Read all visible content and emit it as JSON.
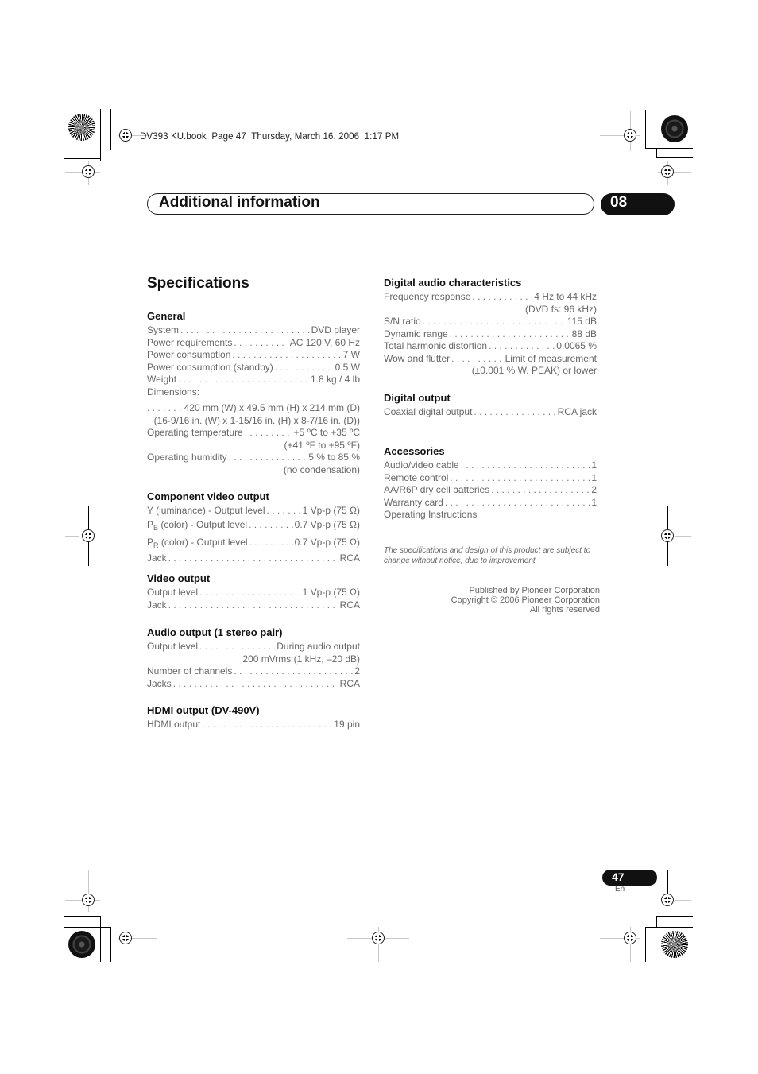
{
  "print_header": "DV393 KU.book  Page 47  Thursday, March 16, 2006  1:17 PM",
  "section_bar": {
    "title": "Additional information",
    "chapter": "08"
  },
  "page_title": "Specifications",
  "left_column": [
    {
      "heading": "General",
      "rows": [
        {
          "label": "System",
          "value": "DVD player"
        },
        {
          "label": "Power requirements",
          "value": "AC 120 V, 60 Hz"
        },
        {
          "label": "Power consumption",
          "value": "7 W"
        },
        {
          "label": "Power consumption (standby)",
          "value": "0.5 W"
        },
        {
          "label": "Weight",
          "value": "1.8 kg / 4 lb"
        }
      ],
      "dimensions_label": "Dimensions:",
      "dimensions_value": "420 mm (W) x 49.5 mm (H) x 214 mm (D)",
      "dimensions_inches": "(16-9/16 in. (W) x 1-15/16 in. (H) x 8-7/16 in. (D))",
      "rows2": [
        {
          "label": "Operating temperature",
          "value": "+5 ºC to +35 ºC",
          "cont": "(+41 ºF to +95 ºF)"
        },
        {
          "label": "Operating humidity",
          "value": "5 % to 85 %",
          "cont": "(no condensation)"
        }
      ]
    },
    {
      "heading": "Component video output",
      "rows": [
        {
          "label": "Y (luminance) - Output level",
          "value": "1 Vp-p (75 Ω)"
        },
        {
          "label_main": "P",
          "label_sub": "B",
          "label_rest": " (color) - Output level",
          "value": "0.7 Vp-p (75 Ω)"
        },
        {
          "label_main": "P",
          "label_sub": "R",
          "label_rest": " (color) - Output level",
          "value": "0.7 Vp-p (75 Ω)"
        },
        {
          "label": "Jack",
          "value": "RCA"
        }
      ]
    },
    {
      "heading": "Video output",
      "rows": [
        {
          "label": "Output level",
          "value": "1 Vp-p (75 Ω)"
        },
        {
          "label": "Jack",
          "value": "RCA"
        }
      ]
    },
    {
      "heading": "Audio output (1 stereo pair)",
      "rows": [
        {
          "label": "Output level",
          "value": "During audio output",
          "cont": "200 mVrms (1 kHz, –20 dB)"
        },
        {
          "label": "Number of channels",
          "value": "2"
        },
        {
          "label": "Jacks",
          "value": "RCA"
        }
      ]
    },
    {
      "heading": "HDMI output (DV-490V)",
      "rows": [
        {
          "label": "HDMI output",
          "value": "19 pin"
        }
      ]
    }
  ],
  "right_column": [
    {
      "heading": "Digital audio characteristics",
      "rows": [
        {
          "label": "Frequency response",
          "value": "4 Hz to 44 kHz",
          "cont": "(DVD fs: 96 kHz)"
        },
        {
          "label": "S/N ratio",
          "value": "115 dB"
        },
        {
          "label": "Dynamic range",
          "value": "88 dB"
        },
        {
          "label": "Total harmonic distortion",
          "value": "0.0065 %"
        },
        {
          "label": "Wow and flutter",
          "value": "Limit of measurement",
          "cont": "(±0.001 % W. PEAK) or lower"
        }
      ]
    },
    {
      "heading": "Digital output",
      "rows": [
        {
          "label": "Coaxial digital output",
          "value": "RCA jack"
        }
      ]
    },
    {
      "heading": "Accessories",
      "rows": [
        {
          "label": "Audio/video cable",
          "value": "1"
        },
        {
          "label": "Remote control",
          "value": "1"
        },
        {
          "label": "AA/R6P dry cell batteries",
          "value": "2"
        },
        {
          "label": "Warranty card",
          "value": "1"
        }
      ],
      "extra": "Operating Instructions"
    }
  ],
  "note": "The specifications and design of this product are subject to change without notice, due to improvement.",
  "publisher": {
    "line1": "Published by Pioneer Corporation.",
    "line2": "Copyright © 2006 Pioneer Corporation.",
    "line3": "All rights reserved."
  },
  "footer": {
    "page_number": "47",
    "language": "En"
  }
}
